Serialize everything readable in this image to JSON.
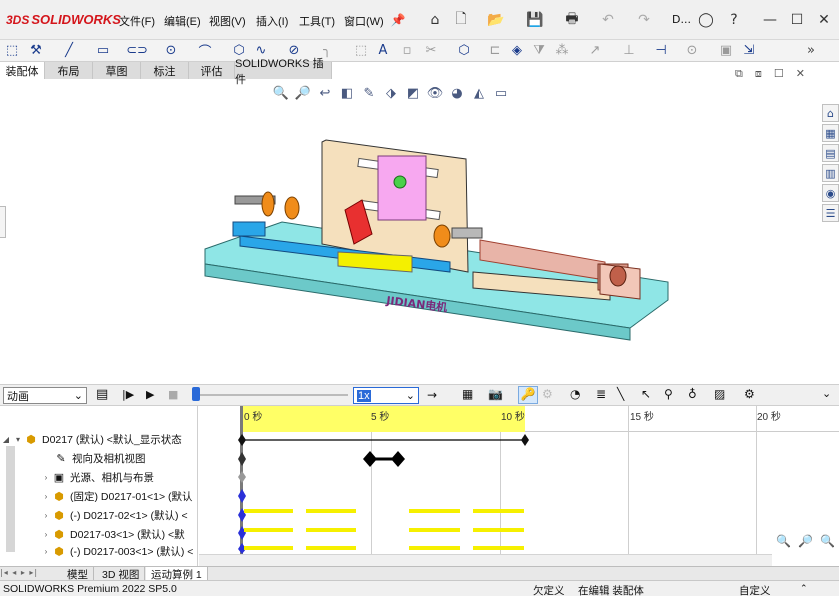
{
  "app": {
    "brand": "SOLIDWORKS",
    "brand_prefix": "3DS"
  },
  "menu": [
    "文件(F)",
    "编辑(E)",
    "视图(V)",
    "插入(I)",
    "工具(T)",
    "窗口(W)"
  ],
  "title_short": "D...",
  "command_tabs": [
    "装配体",
    "布局",
    "草图",
    "标注",
    "评估",
    "SOLIDWORKS 插件"
  ],
  "model": {
    "plate_text": "JIDIAN电机"
  },
  "motion": {
    "study_type": "动画",
    "speed": "1x",
    "ruler_labels": [
      "0 秒",
      "5 秒",
      "10 秒",
      "15 秒",
      "20 秒"
    ]
  },
  "tree": {
    "root": "D0217 (默认) <默认_显示状态",
    "items": [
      "视向及相机视图",
      "光源、相机与布景",
      "(固定) D0217-01<1> (默认",
      "(-) D0217-02<1> (默认) <",
      "D0217-03<1> (默认) <默",
      "(-) D0217-003<1> (默认) <"
    ]
  },
  "bottom_tabs": [
    "模型",
    "3D 视图",
    "运动算例 1"
  ],
  "status": {
    "product": "SOLIDWORKS Premium 2022 SP5.0",
    "defined": "欠定义",
    "editing": "在编辑 装配体",
    "custom": "自定义"
  },
  "colors": {
    "brand_red": "#d4151b",
    "timeline_yellow": "#ffff66",
    "base_cyan": "#8fe6e6"
  }
}
